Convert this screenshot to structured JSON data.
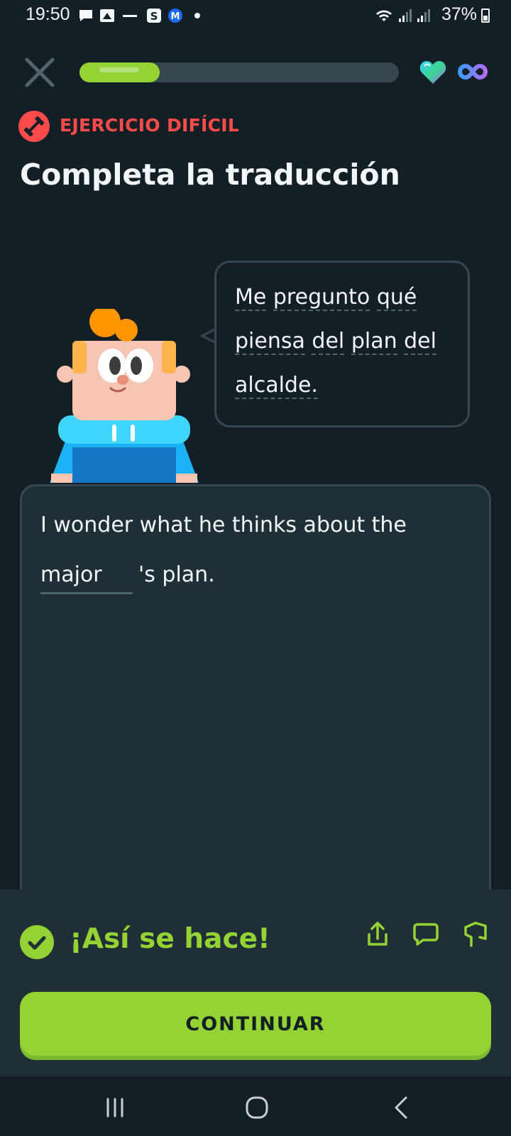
{
  "status_bar": {
    "time": "19:50",
    "battery": "37%",
    "icons": [
      "message-icon",
      "gallery-icon",
      "app-icon",
      "s-app-icon",
      "m-app-icon",
      "dot-icon",
      "wifi-icon",
      "signal-icon",
      "signal-icon",
      "battery-icon"
    ]
  },
  "header": {
    "close_icon": "close-icon",
    "progress": 0.25,
    "hearts_icon": "heart-icon",
    "infinity_icon": "infinity-icon"
  },
  "challenge": {
    "tag": "EJERCICIO DIFÍCIL",
    "title": "Completa la traducción"
  },
  "bubble": {
    "words": [
      "Me",
      "pregunto",
      "qué",
      "piensa",
      "del",
      "plan",
      "del",
      "alcalde."
    ]
  },
  "answer": {
    "text_before": "I wonder what he thinks about the",
    "blank_value": "major",
    "text_after": "'s plan."
  },
  "feedback": {
    "title": "¡Así se hace!",
    "continue_label": "CONTINUAR"
  },
  "colors": {
    "background": "#131f24",
    "panel": "#202f36",
    "accent_green": "#93d333",
    "hard_red": "#ff4b4b"
  }
}
